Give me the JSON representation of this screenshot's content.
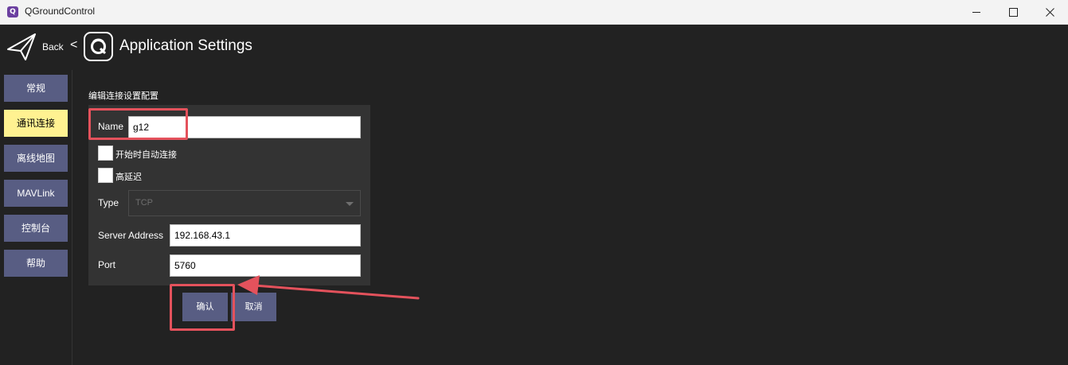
{
  "window": {
    "title": "QGroundControl",
    "app_icon_glyph": "Q"
  },
  "header": {
    "back_label": "Back",
    "chevron": "<",
    "title": "Application Settings"
  },
  "sidebar": {
    "items": [
      {
        "label": "常规",
        "active": false
      },
      {
        "label": "通讯连接",
        "active": true
      },
      {
        "label": "离线地图",
        "active": false
      },
      {
        "label": "MAVLink",
        "active": false
      },
      {
        "label": "控制台",
        "active": false
      },
      {
        "label": "帮助",
        "active": false
      }
    ]
  },
  "form": {
    "section_title": "编辑连接设置配置",
    "name_label": "Name",
    "name_value": "g12",
    "autoconnect_label": "开始时自动连接",
    "high_latency_label": "高延迟",
    "type_label": "Type",
    "type_value": "TCP",
    "server_label": "Server Address",
    "server_value": "192.168.43.1",
    "port_label": "Port",
    "port_value": "5760"
  },
  "actions": {
    "ok_label": "确认",
    "cancel_label": "取消"
  },
  "colors": {
    "active_tab": "#fff291",
    "button": "#585d83",
    "annotation": "#e4525c"
  }
}
